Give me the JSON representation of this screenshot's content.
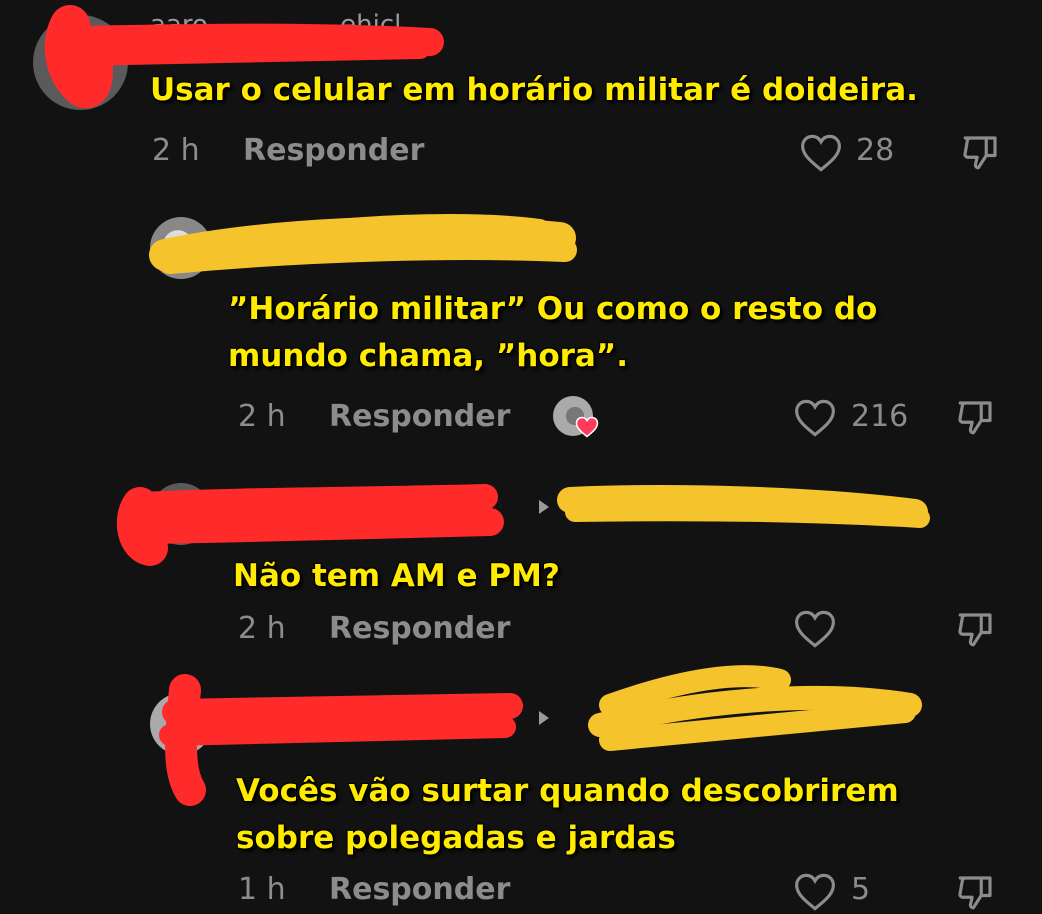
{
  "comments": [
    {
      "caption_lines": [
        "Usar o celular em horário militar é doideira."
      ],
      "time": "2 h",
      "reply_label": "Responder",
      "likes": "28"
    },
    {
      "caption_lines": [
        "”Horário militar”  Ou como o resto do",
        "mundo chama, ”hora”."
      ],
      "time": "2 h",
      "reply_label": "Responder",
      "likes": "216"
    },
    {
      "caption_lines": [
        "Não tem AM e PM?"
      ],
      "time": "2 h",
      "reply_label": "Responder",
      "likes": ""
    },
    {
      "caption_lines": [
        "Vocês vão surtar quando descobrirem",
        "sobre polegadas e jardas"
      ],
      "time": "1 h",
      "reply_label": "Responder",
      "likes": "5"
    }
  ],
  "colors": {
    "background": "#121212",
    "caption": "#ffeb00",
    "meta": "#8c8c8c",
    "redact_red": "#ff2a2a",
    "redact_yellow": "#f5c32c",
    "liked_heart": "#ff3b5c"
  },
  "icons": [
    "heart-outline-icon",
    "dislike-icon",
    "reply-arrow-icon",
    "creator-liked-icon"
  ]
}
